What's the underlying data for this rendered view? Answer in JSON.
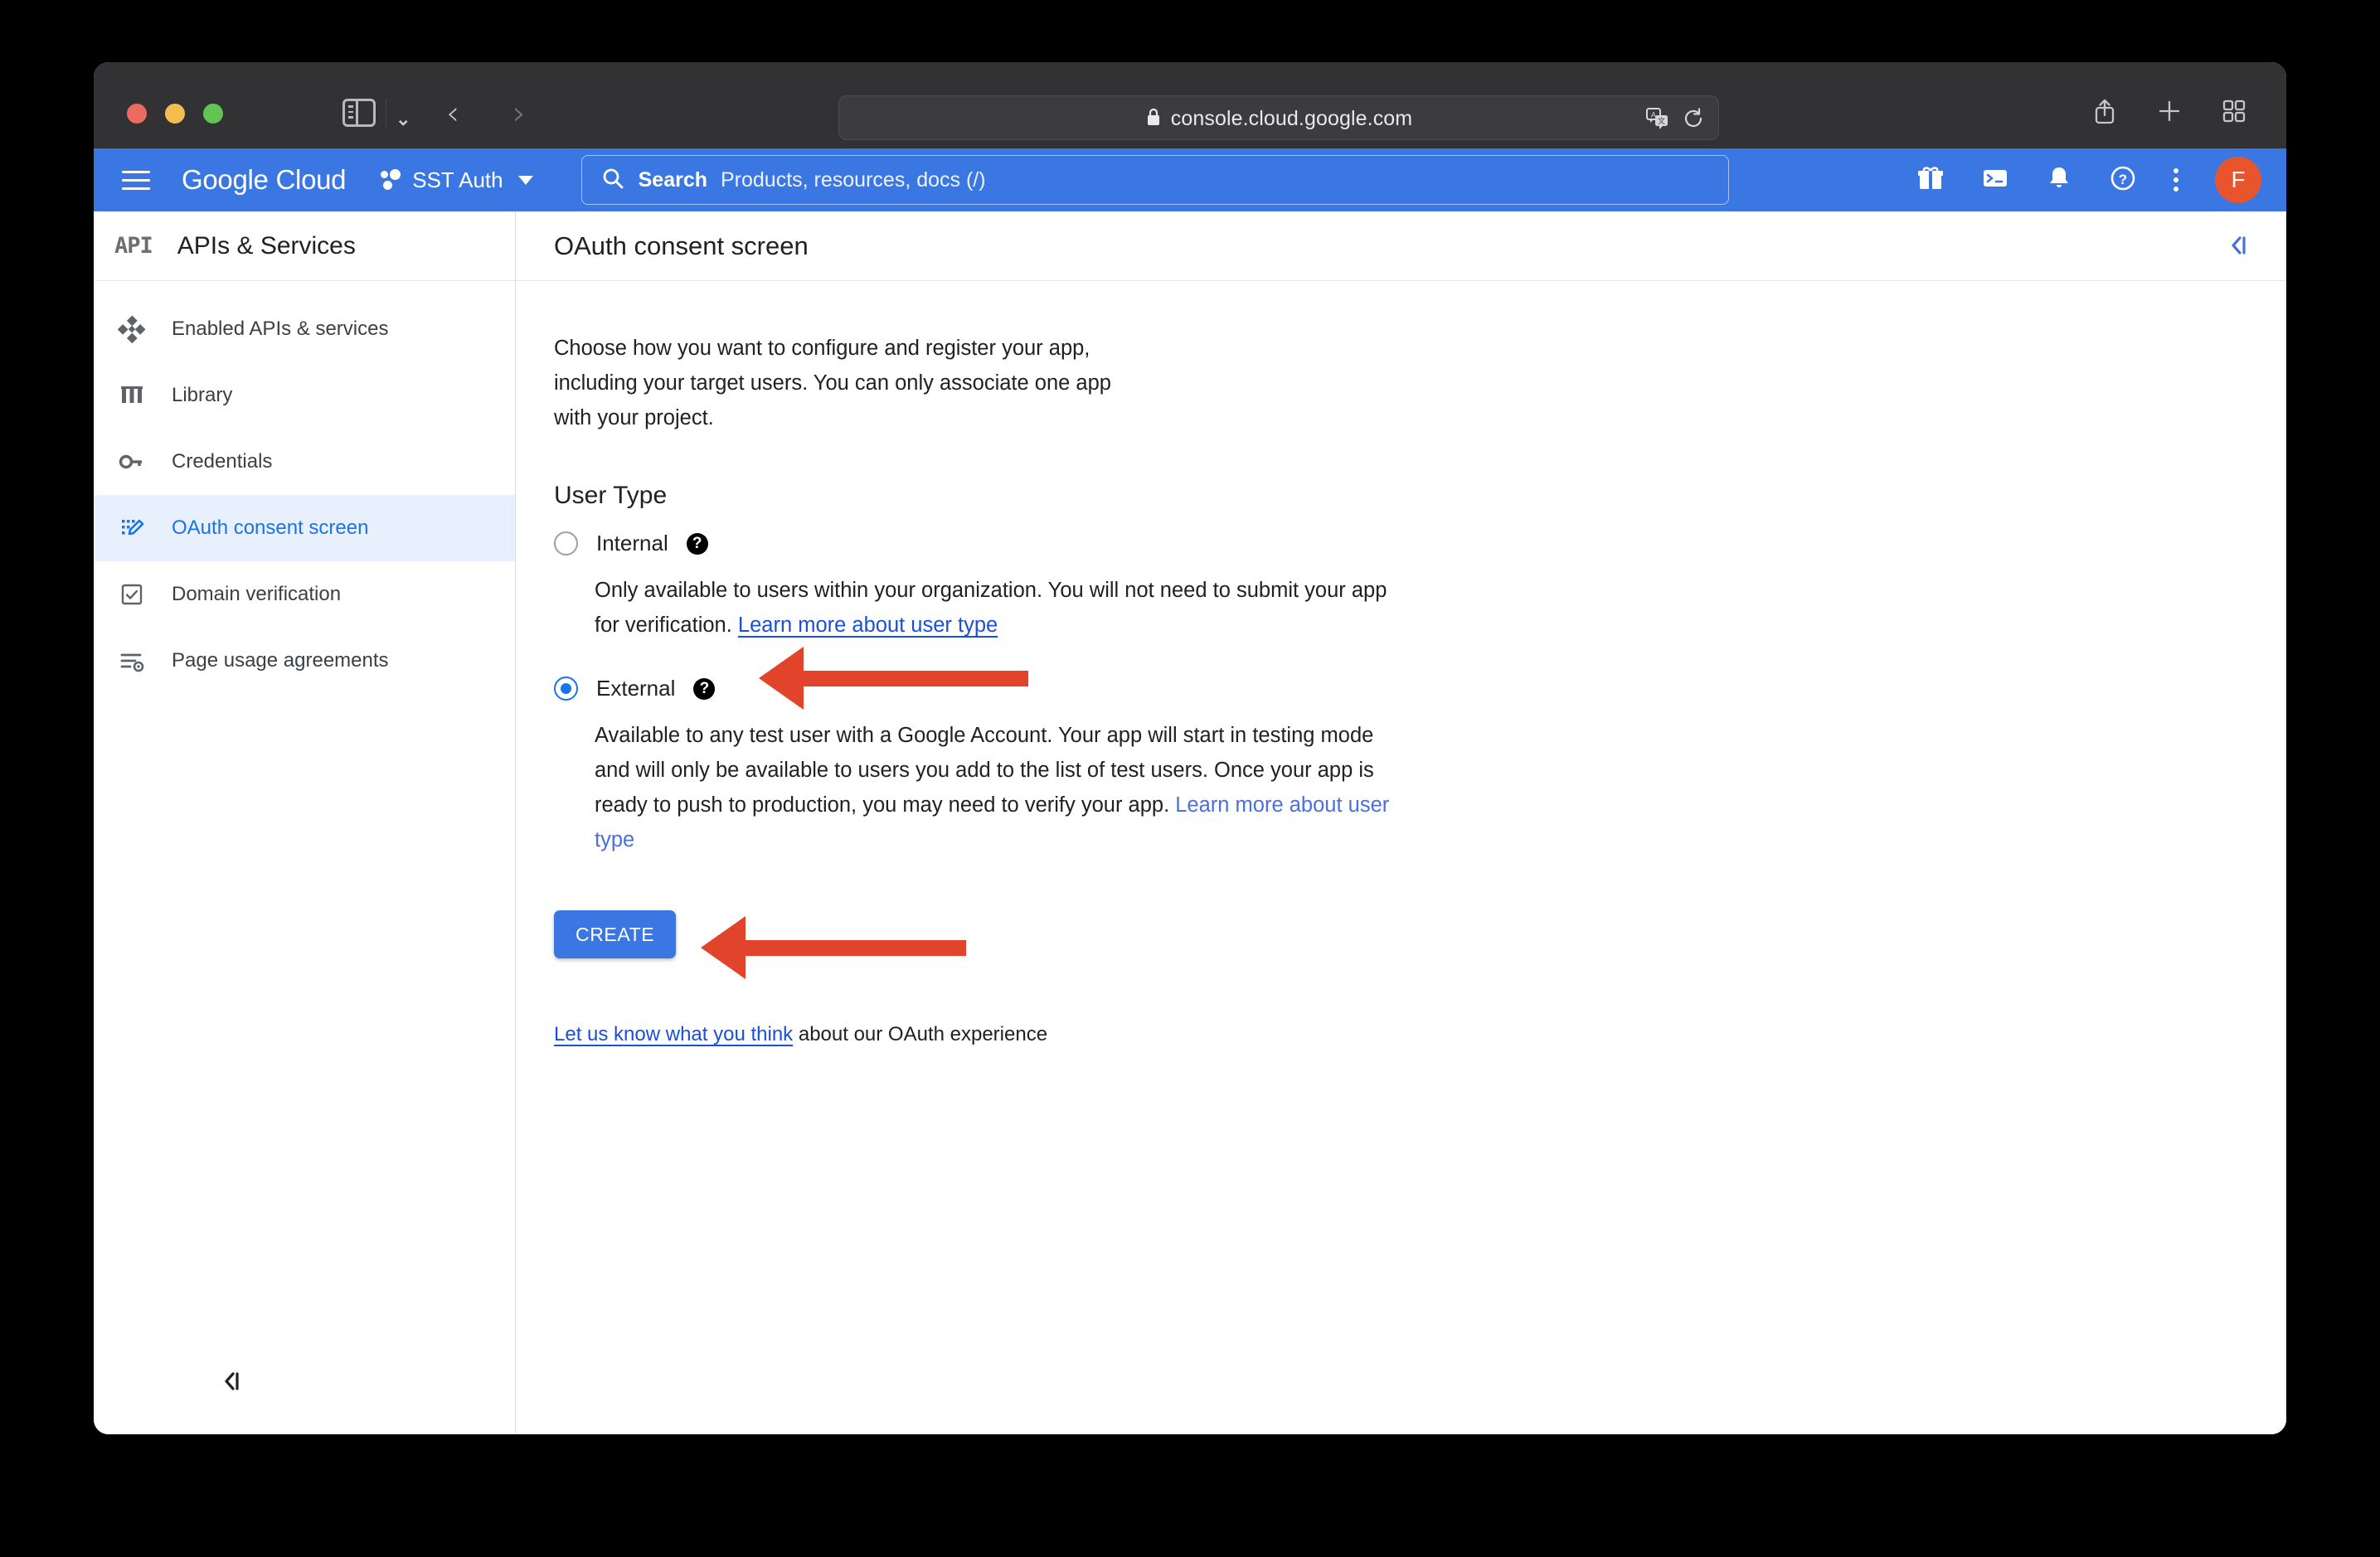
{
  "browser": {
    "url": "console.cloud.google.com",
    "lock_icon": "lock-icon",
    "translate_icon": "translate-icon",
    "reload_icon": "reload-icon",
    "share_icon": "share-icon",
    "new_tab_icon": "plus-icon",
    "tab_overview_icon": "grid-icon",
    "sidebar_toggle_icon": "sidebar-toggle-icon",
    "back_icon": "chevron-left-icon",
    "forward_icon": "chevron-right-icon",
    "dropdown_icon": "chevron-down-icon"
  },
  "header": {
    "menu_icon": "hamburger-icon",
    "brand_google": "Google",
    "brand_cloud": "Cloud",
    "project_name": "SST Auth",
    "project_icon": "project-dots-icon",
    "search_label": "Search",
    "search_placeholder": "Products, resources, docs (/)",
    "search_icon": "search-icon",
    "icons": [
      "gift-icon",
      "cloud-shell-icon",
      "notifications-bell-icon",
      "help-icon",
      "more-vert-icon"
    ],
    "avatar_initial": "F",
    "accent_blue": "#3b77e2",
    "avatar_color": "#e8552c"
  },
  "sidebar": {
    "badge": "API",
    "title": "APIs & Services",
    "collapse_icon": "collapse-sidebar-icon",
    "items": [
      {
        "label": "Enabled APIs & services",
        "icon": "dashboard-diamond-icon",
        "active": false
      },
      {
        "label": "Library",
        "icon": "library-icon",
        "active": false
      },
      {
        "label": "Credentials",
        "icon": "key-icon",
        "active": false
      },
      {
        "label": "OAuth consent screen",
        "icon": "oauth-consent-icon",
        "active": true
      },
      {
        "label": "Domain verification",
        "icon": "checkbox-icon",
        "active": false
      },
      {
        "label": "Page usage agreements",
        "icon": "page-usage-icon",
        "active": false
      }
    ]
  },
  "page": {
    "title": "OAuth consent screen",
    "collapse_panel_icon": "collapse-panel-icon",
    "description": "Choose how you want to configure and register your app, including your target users. You can only associate one app with your project.",
    "section_title": "User Type",
    "options": [
      {
        "label": "Internal",
        "selected": false,
        "help_icon": "help-circle-icon",
        "description": "Only available to users within your organization. You will not need to submit your app for verification. ",
        "link": "Learn more about user type"
      },
      {
        "label": "External",
        "selected": true,
        "help_icon": "help-circle-icon",
        "description": "Available to any test user with a Google Account. Your app will start in testing mode and will only be available to users you add to the list of test users. Once your app is ready to push to production, you may need to verify your app. ",
        "link": "Learn more about user type"
      }
    ],
    "create_button": "CREATE",
    "feedback_link": "Let us know what you think",
    "feedback_rest": " about our OAuth experience"
  },
  "annotations": {
    "color": "#e1432b",
    "arrows": [
      {
        "name": "arrow-pointing-external-radio"
      },
      {
        "name": "arrow-pointing-create-button"
      }
    ]
  }
}
